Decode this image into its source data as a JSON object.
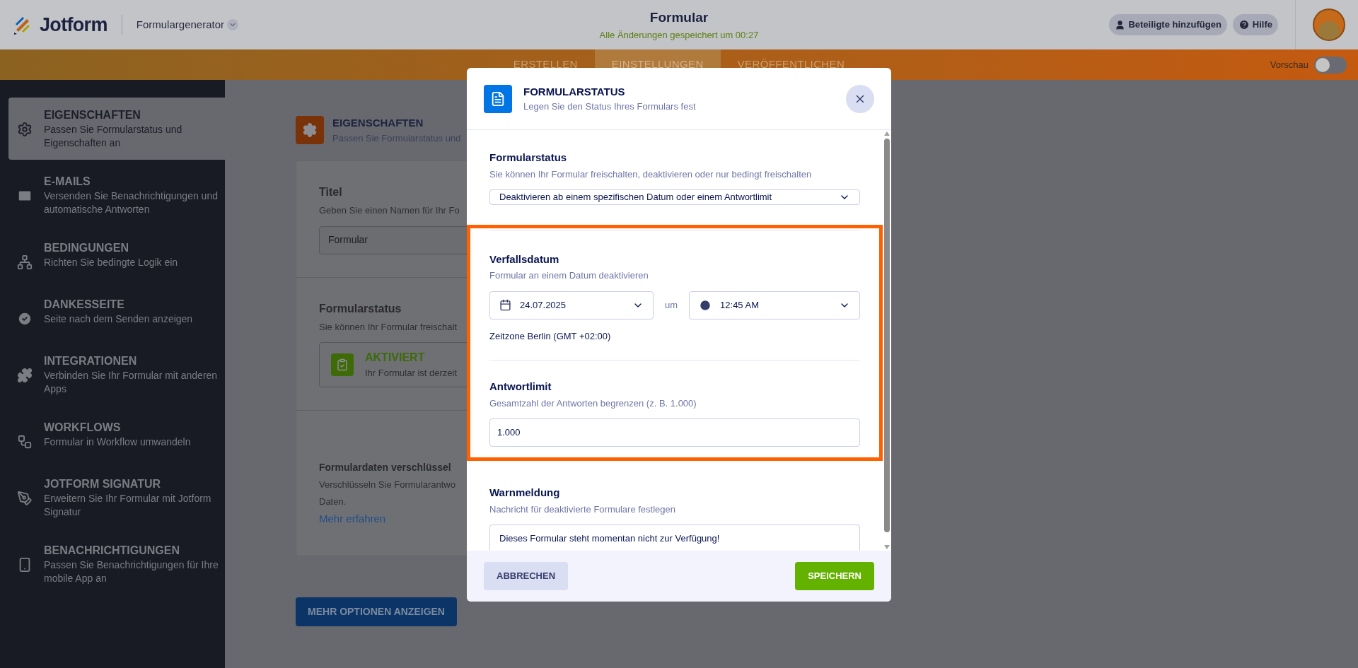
{
  "header": {
    "logo": "Jotform",
    "product": "Formulargenerator",
    "title": "Formular",
    "save_status": "Alle Änderungen gespeichert um 00:27",
    "buttons": [
      {
        "label": "Beteiligte hinzufügen",
        "kind": "user"
      },
      {
        "label": "Hilfe",
        "kind": "help"
      }
    ]
  },
  "tabs": [
    {
      "label": "ERSTELLEN",
      "selected": false
    },
    {
      "label": "EINSTELLUNGEN",
      "selected": true
    },
    {
      "label": "VERÖFFENTLICHEN",
      "selected": false
    }
  ],
  "preview": {
    "label": "Vorschau",
    "on": false
  },
  "sidebar": {
    "items": [
      {
        "title": "EIGENSCHAFTEN",
        "description": "Passen Sie Formularstatus und Eigenschaften an",
        "selected": true
      },
      {
        "title": "E-MAILS",
        "description": "Versenden Sie Benachrichtigungen und automatische Antworten",
        "selected": false
      },
      {
        "title": "BEDINGUNGEN",
        "description": "Richten Sie bedingte Logik ein",
        "selected": false
      },
      {
        "title": "DANKESSEITE",
        "description": "Seite nach dem Senden anzeigen",
        "selected": false
      },
      {
        "title": "INTEGRATIONEN",
        "description": "Verbinden Sie Ihr Formular mit anderen Apps",
        "selected": false
      },
      {
        "title": "WORKFLOWS",
        "description": "Formular in Workflow umwandeln",
        "selected": false
      },
      {
        "title": "JOTFORM SIGNATUR",
        "description": "Erweitern Sie Ihr Formular mit Jotform Signatur",
        "selected": false
      },
      {
        "title": "BENACHRICHTIGUNGEN",
        "description": "Passen Sie Benachrichtigungen für Ihre mobile App an",
        "selected": false
      }
    ]
  },
  "settings": {
    "title": "EIGENSCHAFTEN",
    "subtitle": "Passen Sie Formularstatus und",
    "title_section": {
      "label": "Titel",
      "description": "Geben Sie einen Namen für Ihr Fo",
      "value": "Formular"
    },
    "status_section": {
      "label": "Formularstatus",
      "description": "Sie können Ihr Formular freischalt",
      "status": "AKTIVIERT",
      "status_text": "Ihr Formular ist derzeit"
    },
    "encrypt_section": {
      "label": "Formulardaten verschlüssel",
      "description": "Verschlüsseln Sie Formularantwo",
      "description_2": "Daten.",
      "link": "Mehr erfahren"
    },
    "more_button": "MEHR OPTIONEN ANZEIGEN"
  },
  "modal": {
    "title": "FORMULARSTATUS",
    "subtitle": "Legen Sie den Status Ihres Formulars fest",
    "status": {
      "label": "Formularstatus",
      "description": "Sie können Ihr Formular freischalten, deaktivieren oder nur bedingt freischalten",
      "value": "Deaktivieren ab einem spezifischen Datum oder einem Antwortlimit"
    },
    "expiry": {
      "label": "Verfallsdatum",
      "description": "Formular an einem Datum deaktivieren",
      "date": "24.07.2025",
      "connector": "um",
      "time": "12:45 AM",
      "timezone": "Zeitzone Berlin (GMT +02:00)"
    },
    "limit": {
      "label": "Antwortlimit",
      "description": "Gesamtzahl der Antworten begrenzen (z. B. 1.000)",
      "value": "1.000"
    },
    "warning": {
      "label": "Warnmeldung",
      "description": "Nachricht für deaktivierte Formulare festlegen",
      "value": "Dieses Formular steht momentan nicht zur Verfügung!"
    },
    "cancel": "ABBRECHEN",
    "save": "SPEICHERN"
  }
}
